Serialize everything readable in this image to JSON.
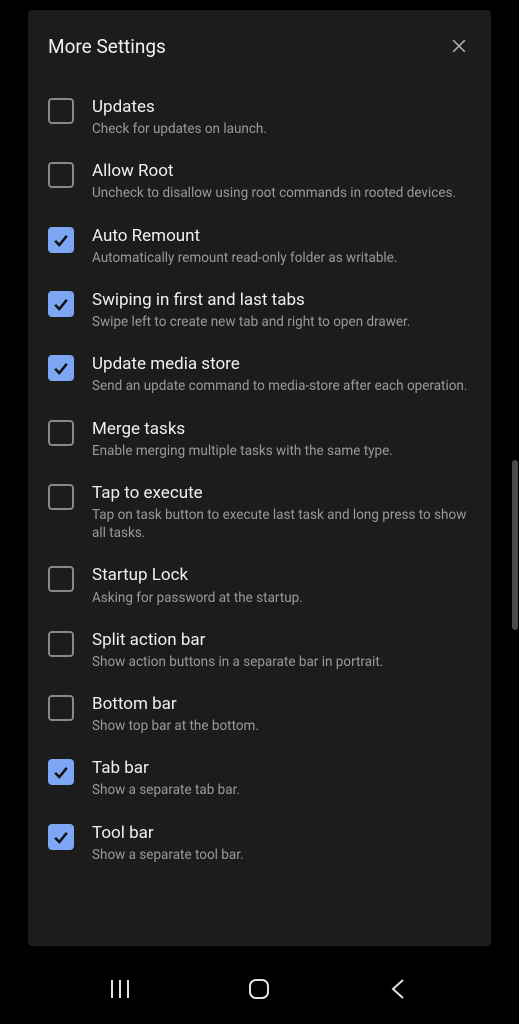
{
  "dialog": {
    "title": "More Settings"
  },
  "settings": [
    {
      "title": "Updates",
      "description": "Check for updates on launch.",
      "checked": false
    },
    {
      "title": "Allow Root",
      "description": "Uncheck to disallow using root commands in rooted devices.",
      "checked": false
    },
    {
      "title": "Auto Remount",
      "description": "Automatically remount read-only folder as writable.",
      "checked": true
    },
    {
      "title": "Swiping in first and last tabs",
      "description": "Swipe left to create new tab and right to open drawer.",
      "checked": true
    },
    {
      "title": "Update media store",
      "description": "Send an update command to media-store after each operation.",
      "checked": true
    },
    {
      "title": "Merge tasks",
      "description": "Enable merging multiple tasks with the same type.",
      "checked": false
    },
    {
      "title": "Tap to execute",
      "description": "Tap on task button to execute last task and long press to show all tasks.",
      "checked": false
    },
    {
      "title": "Startup Lock",
      "description": "Asking for password at the startup.",
      "checked": false
    },
    {
      "title": "Split action bar",
      "description": "Show action buttons in a separate bar in portrait.",
      "checked": false
    },
    {
      "title": "Bottom bar",
      "description": "Show top bar at the bottom.",
      "checked": false
    },
    {
      "title": "Tab bar",
      "description": "Show a separate tab bar.",
      "checked": true
    },
    {
      "title": "Tool bar",
      "description": "Show a separate tool bar.",
      "checked": true
    }
  ]
}
